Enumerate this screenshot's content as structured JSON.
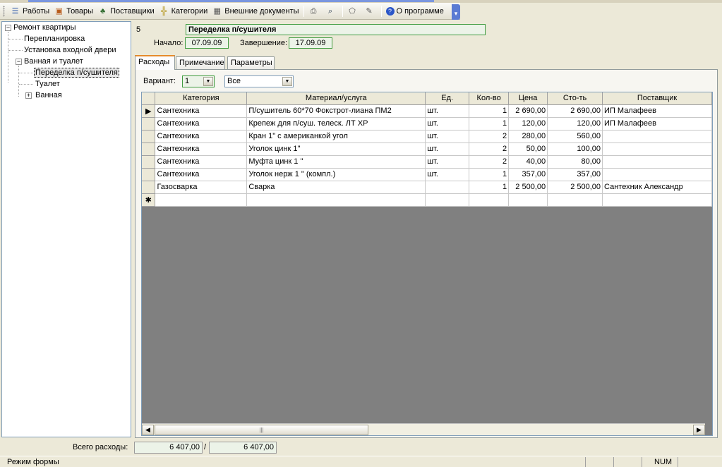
{
  "toolbar": {
    "items": [
      {
        "label": "Работы",
        "icon": "list-icon"
      },
      {
        "label": "Товары",
        "icon": "box-icon"
      },
      {
        "label": "Поставщики",
        "icon": "people-icon"
      },
      {
        "label": "Категории",
        "icon": "tree-icon"
      },
      {
        "label": "Внешние документы",
        "icon": "table-icon"
      }
    ],
    "about_label": "О программе"
  },
  "tree": {
    "root": "Ремонт квартиры",
    "items": [
      "Перепланировка",
      "Установка входной двери",
      "Ванная и туалет",
      "Переделка п/сушителя",
      "Туалет",
      "Ванная"
    ]
  },
  "work": {
    "id": "5",
    "title": "Переделка п/сушителя",
    "start_label": "Начало:",
    "start": "07.09.09",
    "end_label": "Завершение:",
    "end": "17.09.09"
  },
  "tabs": [
    "Расходы",
    "Примечание",
    "Параметры"
  ],
  "variant": {
    "label": "Вариант:",
    "value": "1",
    "filter": "Все"
  },
  "grid": {
    "columns": [
      "Категория",
      "Материал/услуга",
      "Ед.",
      "Кол-во",
      "Цена",
      "Сто-ть",
      "Поставщик"
    ],
    "rows": [
      [
        "Сантехника",
        "П/сушитель 60*70 Фокстрот-лиана ПМ2",
        "шт.",
        "1",
        "2 690,00",
        "2 690,00",
        "ИП Малафеев"
      ],
      [
        "Сантехника",
        "Крепеж для п/суш. телеск. ЛТ ХР",
        "шт.",
        "1",
        "120,00",
        "120,00",
        "ИП Малафеев"
      ],
      [
        "Сантехника",
        "Кран 1\" с американкой угол",
        "шт.",
        "2",
        "280,00",
        "560,00",
        ""
      ],
      [
        "Сантехника",
        "Уголок цинк 1\"",
        "шт.",
        "2",
        "50,00",
        "100,00",
        ""
      ],
      [
        "Сантехника",
        "Муфта цинк 1 \"",
        "шт.",
        "2",
        "40,00",
        "80,00",
        ""
      ],
      [
        "Сантехника",
        "Уголок нерж 1 \" (компл.)",
        "шт.",
        "1",
        "357,00",
        "357,00",
        ""
      ],
      [
        "Газосварка",
        "Сварка",
        "",
        "1",
        "2 500,00",
        "2 500,00",
        "Сантехник Александр"
      ]
    ],
    "new_row_marker": "✱",
    "current_row_marker": "▶"
  },
  "totals": {
    "label": "Всего расходы:",
    "value1": "6 407,00",
    "sep": "/",
    "value2": "6 407,00"
  },
  "status": {
    "mode": "Режим формы",
    "num": "NUM"
  }
}
